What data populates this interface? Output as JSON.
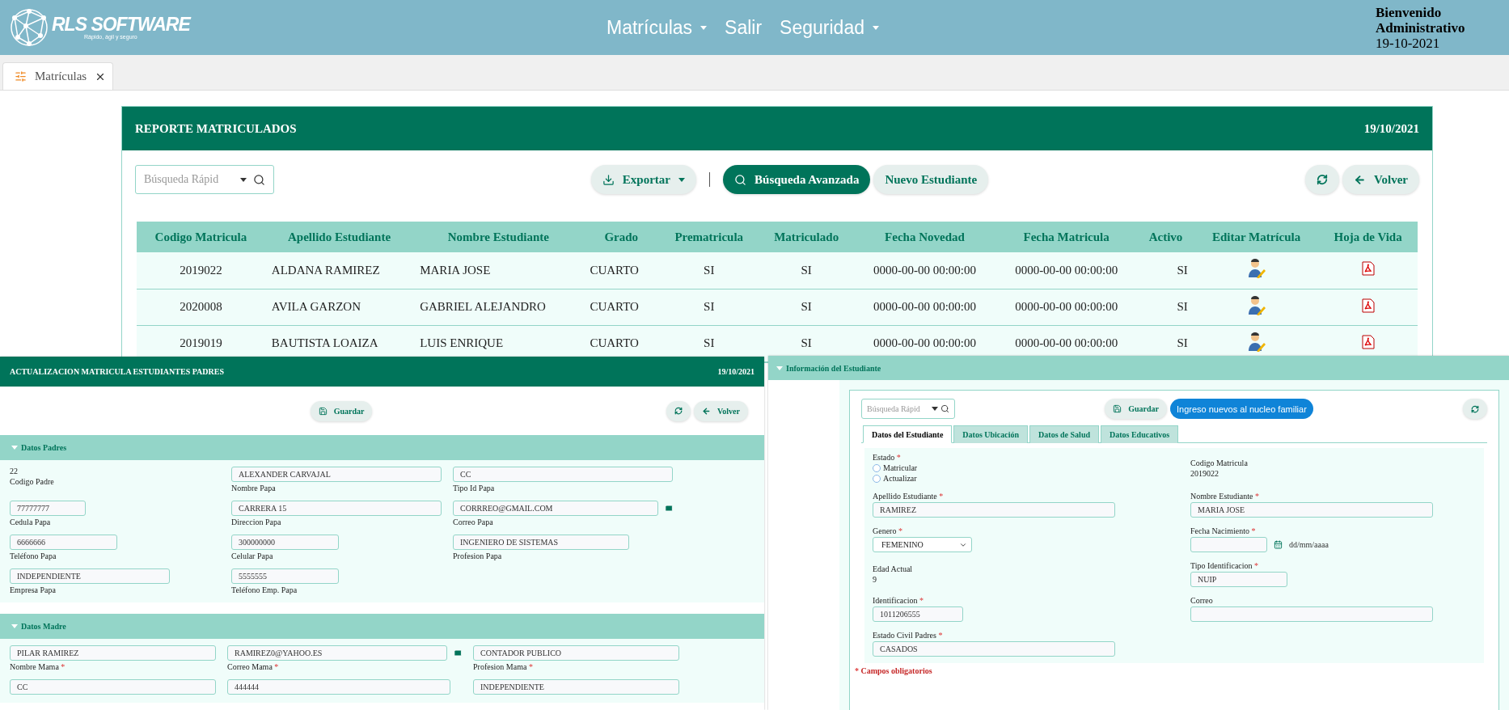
{
  "header": {
    "logo": {
      "name": "RLS SOFTWARE",
      "tagline": "Rápido, ágil y seguro"
    },
    "nav": [
      {
        "label": "Matrículas",
        "dropdown": true
      },
      {
        "label": "Salir",
        "dropdown": false
      },
      {
        "label": "Seguridad",
        "dropdown": true
      }
    ],
    "user": [
      "Bienvenido",
      "Administrativo",
      "19-10-2021"
    ]
  },
  "tabs": [
    {
      "label": "Matrículas",
      "selected": true
    }
  ],
  "report": {
    "title": "REPORTE MATRICULADOS",
    "date": "19/10/2021",
    "search": {
      "placeholder": "Búsqueda Rápid"
    },
    "buttons": [
      {
        "label": "Exportar",
        "kind": "export"
      },
      {
        "label": "Búsqueda Avanzada",
        "kind": "primary"
      },
      {
        "label": "Nuevo Estudiante",
        "kind": "plain"
      }
    ],
    "actions": [
      {
        "kind": "refresh"
      },
      {
        "kind": "back",
        "label": "Volver"
      }
    ],
    "table": {
      "columns": [
        "Codigo Matricula",
        "Apellido Estudiante",
        "Nombre Estudiante",
        "Grado",
        "Prematricula",
        "Matriculado",
        "Fecha Novedad",
        "Fecha Matricula",
        "Activo",
        "Editar Matrícula",
        "Hoja de Vida"
      ],
      "rows": [
        [
          "2019022",
          "ALDANA RAMIREZ",
          "MARIA JOSE",
          "CUARTO",
          "SI",
          "SI",
          "0000-00-00 00:00:00",
          "0000-00-00 00:00:00",
          "SI"
        ],
        [
          "2020008",
          "AVILA GARZON",
          "GABRIEL ALEJANDRO",
          "CUARTO",
          "SI",
          "SI",
          "0000-00-00 00:00:00",
          "0000-00-00 00:00:00",
          "SI"
        ],
        [
          "2019019",
          "BAUTISTA LOAIZA",
          "LUIS ENRIQUE",
          "CUARTO",
          "SI",
          "SI",
          "0000-00-00 00:00:00",
          "0000-00-00 00:00:00",
          "SI"
        ]
      ]
    }
  },
  "parents_panel": {
    "title": "ACTUALIZACION MATRICULA ESTUDIANTES PADRES",
    "date": "19/10/2021",
    "save": "Guardar",
    "back": "Volver",
    "sections": [
      {
        "title": "Datos Padres",
        "fields": [
          {
            "kind": "text",
            "value": "22",
            "label": "Codigo Padre"
          },
          {
            "kind": "input",
            "value": "ALEXANDER CARVAJAL",
            "label": "Nombre Papa"
          },
          {
            "kind": "input",
            "value": "CC",
            "label": "Tipo Id Papa"
          },
          {
            "kind": "input",
            "value": "77777777",
            "label": "Cedula Papa"
          },
          {
            "kind": "input",
            "value": "CARRERA 15",
            "label": "Direccion Papa"
          },
          {
            "kind": "email",
            "value": "CORRREO@GMAIL.COM",
            "label": "Correo Papa"
          },
          {
            "kind": "input",
            "value": "6666666",
            "label": "Teléfono Papa"
          },
          {
            "kind": "input",
            "value": "300000000",
            "label": "Celular Papa"
          },
          {
            "kind": "input",
            "value": "INGENIERO DE SISTEMAS",
            "label": "Profesion Papa"
          },
          {
            "kind": "input",
            "value": "INDEPENDIENTE",
            "label": "Empresa Papa"
          },
          {
            "kind": "input",
            "value": "5555555",
            "label": "Teléfono Emp. Papa"
          }
        ]
      },
      {
        "title": "Datos Madre",
        "fields": [
          {
            "kind": "input",
            "value": "PILAR RAMIREZ",
            "label": "Nombre Mama",
            "required_mark": "*"
          },
          {
            "kind": "email",
            "value": "RAMIREZ0@YAHOO.ES",
            "label": "Correo Mama",
            "required_mark": "*"
          },
          {
            "kind": "input",
            "value": "CONTADOR PUBLICO",
            "label": "Profesion Mama",
            "required_mark": "*"
          },
          {
            "kind": "input",
            "value": "CC"
          },
          {
            "kind": "input",
            "value": "444444"
          },
          {
            "kind": "input",
            "value": "INDEPENDIENTE"
          }
        ]
      }
    ]
  },
  "student_panel": {
    "title": "Información del Estudiante",
    "search": {
      "placeholder": "Búsqueda Rápid"
    },
    "save": "Guardar",
    "add_button": "Ingreso nuevos al nucleo familiar",
    "tabs": [
      {
        "label": "Datos del Estudiante",
        "selected": true
      },
      {
        "label": "Datos Ubicación",
        "selected": false
      },
      {
        "label": "Datos de Salud",
        "selected": false
      },
      {
        "label": "Datos Educativos",
        "selected": false
      }
    ],
    "fields": [
      {
        "kind": "radio",
        "label": "Estado",
        "required_mark": "*",
        "options": [
          {
            "label": "Matricular",
            "checked": false
          },
          {
            "label": "Actualizar",
            "checked": false
          }
        ]
      },
      {
        "kind": "text",
        "label": "Codigo Matricula",
        "value": "2019022"
      },
      {
        "kind": "input",
        "label": "Apellido Estudiante",
        "required_mark": "*",
        "value": "RAMIREZ"
      },
      {
        "kind": "input",
        "label": "Nombre Estudiante",
        "required_mark": "*",
        "value": "MARIA JOSE"
      },
      {
        "kind": "select",
        "label": "Genero",
        "required_mark": "*",
        "value": "FEMENINO"
      },
      {
        "kind": "date",
        "label": "Fecha Nacimiento",
        "required_mark": "*",
        "hint": "dd/mm/aaaa"
      },
      {
        "kind": "text",
        "label": "Edad Actual",
        "value": "9"
      },
      {
        "kind": "input",
        "label": "Tipo Identificacion",
        "required_mark": "*",
        "value": "NUIP"
      },
      {
        "kind": "input",
        "label": "Identificacion",
        "required_mark": "*",
        "value": "1011206555"
      },
      {
        "kind": "input",
        "label": "Correo"
      },
      {
        "kind": "input",
        "label": "Estado Civil Padres",
        "required_mark": "*",
        "value": "CASADOS"
      }
    ],
    "note": {
      "mark": "*",
      "text": "Campos obligatorios"
    }
  }
}
